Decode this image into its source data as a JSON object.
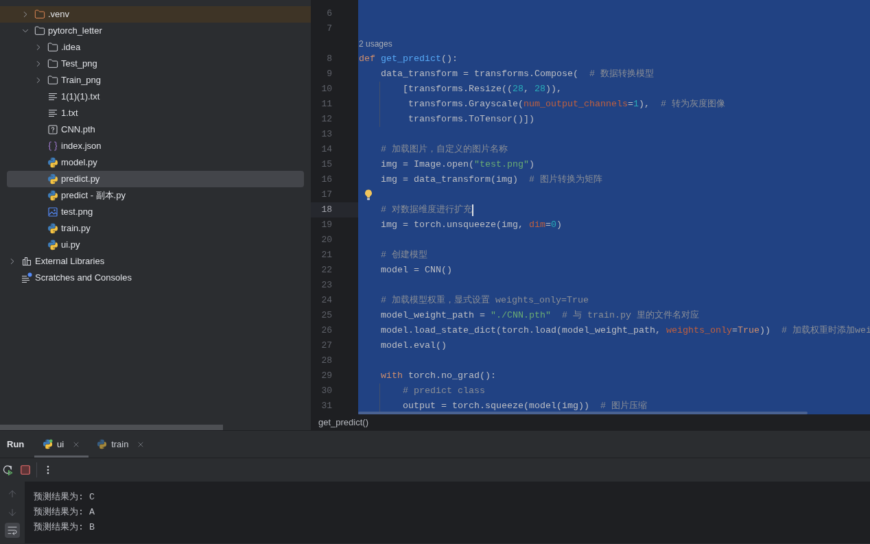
{
  "project_tree": {
    "items": [
      {
        "expanded": true,
        "children": [
          {
            "label": ".venv",
            "kind": "excluded-folder",
            "expanded": false,
            "selected": false
          },
          {
            "label": "pytorch_letter",
            "kind": "folder",
            "expanded": true,
            "selected": false,
            "children": [
              {
                "label": ".idea",
                "kind": "folder",
                "expanded": false,
                "selected": false
              },
              {
                "label": "Test_png",
                "kind": "folder",
                "expanded": false,
                "selected": false
              },
              {
                "label": "Train_png",
                "kind": "folder",
                "expanded": false,
                "selected": false
              },
              {
                "label": "1(1)(1).txt",
                "kind": "text",
                "selected": false
              },
              {
                "label": "1.txt",
                "kind": "text",
                "selected": false
              },
              {
                "label": "CNN.pth",
                "kind": "unknown",
                "selected": false
              },
              {
                "label": "index.json",
                "kind": "json",
                "selected": false
              },
              {
                "label": "model.py",
                "kind": "python",
                "selected": false
              },
              {
                "label": "predict.py",
                "kind": "python",
                "selected": true
              },
              {
                "label": "predict - 副本.py",
                "kind": "python",
                "selected": false
              },
              {
                "label": "test.png",
                "kind": "image",
                "selected": false
              },
              {
                "label": "train.py",
                "kind": "python",
                "selected": false
              },
              {
                "label": "ui.py",
                "kind": "python",
                "selected": false
              }
            ]
          }
        ]
      },
      {
        "label": "External Libraries",
        "kind": "libraries",
        "expanded": false,
        "selected": false
      },
      {
        "label": "Scratches and Consoles",
        "kind": "scratches",
        "selected": false
      }
    ]
  },
  "editor": {
    "lines": [
      {
        "kind": "code",
        "number": "6",
        "current": false
      },
      {
        "kind": "code",
        "number": "7",
        "current": false
      },
      {
        "kind": "usages",
        "text": "2 usages"
      },
      {
        "kind": "code",
        "number": "8",
        "current": false,
        "tokens": [
          {
            "kind": "keyword",
            "text": "def"
          },
          {
            "kind": "function",
            "text": " get_predict"
          },
          {
            "kind": "plain",
            "text": "():"
          }
        ]
      },
      {
        "kind": "code",
        "number": "9",
        "current": false,
        "tokens": [
          {
            "kind": "plain",
            "text": "    data_transform = transforms.Compose(  "
          },
          {
            "kind": "comment",
            "text": "# 数据转换模型"
          }
        ]
      },
      {
        "kind": "code",
        "number": "10",
        "current": false,
        "tokens": [
          {
            "kind": "plain",
            "text": "        [transforms.Resize(("
          },
          {
            "kind": "number",
            "text": "28"
          },
          {
            "kind": "plain",
            "text": ", "
          },
          {
            "kind": "number",
            "text": "28"
          },
          {
            "kind": "plain",
            "text": ")),"
          }
        ]
      },
      {
        "kind": "code",
        "number": "11",
        "current": false,
        "tokens": [
          {
            "kind": "plain",
            "text": "         transforms.Grayscale("
          },
          {
            "kind": "param",
            "text": "num_output_channels"
          },
          {
            "kind": "plain",
            "text": "="
          },
          {
            "kind": "number",
            "text": "1"
          },
          {
            "kind": "plain",
            "text": "),  "
          },
          {
            "kind": "comment",
            "text": "# 转为灰度图像"
          }
        ]
      },
      {
        "kind": "code",
        "number": "12",
        "current": false,
        "tokens": [
          {
            "kind": "plain",
            "text": "         transforms.ToTensor()])"
          }
        ]
      },
      {
        "kind": "code",
        "number": "13",
        "current": false
      },
      {
        "kind": "code",
        "number": "14",
        "current": false,
        "tokens": [
          {
            "kind": "comment",
            "text": "    # 加载图片，自定义的图片名称"
          }
        ]
      },
      {
        "kind": "code",
        "number": "15",
        "current": false,
        "tokens": [
          {
            "kind": "plain",
            "text": "    img = Image.open("
          },
          {
            "kind": "string",
            "text": "\"test.png\""
          },
          {
            "kind": "plain",
            "text": ")"
          }
        ]
      },
      {
        "kind": "code",
        "number": "16",
        "current": false,
        "tokens": [
          {
            "kind": "plain",
            "text": "    img = data_transform(img)  "
          },
          {
            "kind": "comment",
            "text": "# 图片转换为矩阵"
          }
        ]
      },
      {
        "kind": "code",
        "number": "17",
        "current": false,
        "bulb": true
      },
      {
        "kind": "code",
        "number": "18",
        "current": true,
        "tokens": [
          {
            "kind": "comment",
            "text": "    # 对数据维度进行扩充"
          }
        ]
      },
      {
        "kind": "code",
        "number": "19",
        "current": false,
        "tokens": [
          {
            "kind": "plain",
            "text": "    img = torch.unsqueeze(img, "
          },
          {
            "kind": "param",
            "text": "dim"
          },
          {
            "kind": "plain",
            "text": "="
          },
          {
            "kind": "number",
            "text": "0"
          },
          {
            "kind": "plain",
            "text": ")"
          }
        ]
      },
      {
        "kind": "code",
        "number": "20",
        "current": false
      },
      {
        "kind": "code",
        "number": "21",
        "current": false,
        "tokens": [
          {
            "kind": "comment",
            "text": "    # 创建模型"
          }
        ]
      },
      {
        "kind": "code",
        "number": "22",
        "current": false,
        "tokens": [
          {
            "kind": "plain",
            "text": "    model = CNN()"
          }
        ]
      },
      {
        "kind": "code",
        "number": "23",
        "current": false
      },
      {
        "kind": "code",
        "number": "24",
        "current": false,
        "tokens": [
          {
            "kind": "comment",
            "text": "    # 加载模型权重，显式设置 weights_only=True"
          }
        ]
      },
      {
        "kind": "code",
        "number": "25",
        "current": false,
        "tokens": [
          {
            "kind": "plain",
            "text": "    model_weight_path = "
          },
          {
            "kind": "string",
            "text": "\"./CNN.pth\""
          },
          {
            "kind": "comment",
            "text": "  # 与 train.py 里的文件名对应"
          }
        ]
      },
      {
        "kind": "code",
        "number": "26",
        "current": false,
        "tokens": [
          {
            "kind": "plain",
            "text": "    model.load_state_dict(torch.load(model_weight_path, "
          },
          {
            "kind": "param",
            "text": "weights_only"
          },
          {
            "kind": "plain",
            "text": "="
          },
          {
            "kind": "keyword",
            "text": "True"
          },
          {
            "kind": "plain",
            "text": "))  "
          },
          {
            "kind": "comment",
            "text": "# 加载权重时添加wei"
          }
        ]
      },
      {
        "kind": "code",
        "number": "27",
        "current": false,
        "tokens": [
          {
            "kind": "plain",
            "text": "    model.eval()"
          }
        ]
      },
      {
        "kind": "code",
        "number": "28",
        "current": false
      },
      {
        "kind": "code",
        "number": "29",
        "current": false,
        "tokens": [
          {
            "kind": "keyword",
            "text": "    with"
          },
          {
            "kind": "plain",
            "text": " torch.no_grad():"
          }
        ]
      },
      {
        "kind": "code",
        "number": "30",
        "current": false,
        "tokens": [
          {
            "kind": "comment",
            "text": "        # predict class"
          }
        ]
      },
      {
        "kind": "code",
        "number": "31",
        "current": false,
        "tokens": [
          {
            "kind": "plain",
            "text": "        output = torch.squeeze(model(img))  "
          },
          {
            "kind": "comment",
            "text": "# 图片压缩"
          }
        ]
      }
    ],
    "breadcrumb": "get_predict()"
  },
  "run_panel": {
    "title": "Run",
    "tabs": [
      {
        "label": "ui",
        "selected": true,
        "running": true
      },
      {
        "label": "train",
        "selected": false,
        "running": false
      }
    ],
    "console_lines": [
      "预测结果为: C",
      "预测结果为: A",
      "预测结果为: B"
    ]
  }
}
